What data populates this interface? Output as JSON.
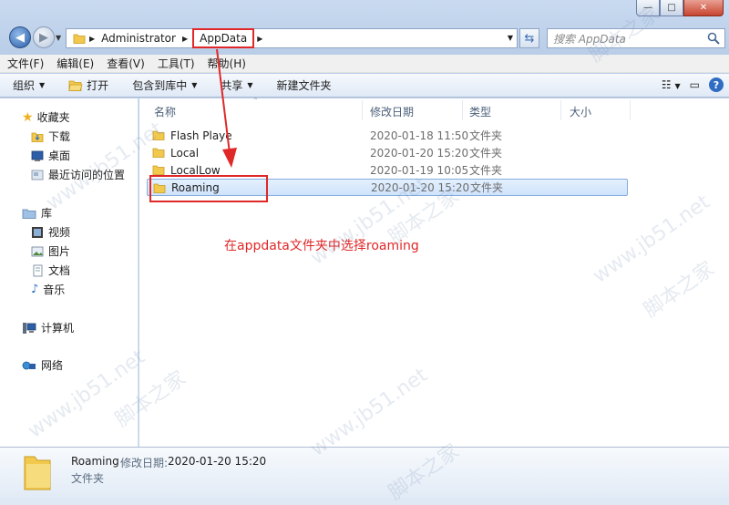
{
  "window": {
    "caption_buttons": {
      "minimize": "—",
      "maximize": "□",
      "close": "✕"
    }
  },
  "address": {
    "segments": [
      "Administrator",
      "AppData"
    ],
    "search_placeholder": "搜索 AppData"
  },
  "menu": [
    "文件(F)",
    "编辑(E)",
    "查看(V)",
    "工具(T)",
    "帮助(H)"
  ],
  "commands": {
    "organize": "组织",
    "open": "打开",
    "include_library": "包含到库中",
    "share": "共享",
    "new_folder": "新建文件夹"
  },
  "nav_pane": {
    "favorites": "收藏夹",
    "downloads": "下载",
    "desktop": "桌面",
    "recent": "最近访问的位置",
    "libraries": "库",
    "videos": "视频",
    "pictures": "图片",
    "documents": "文档",
    "music": "音乐",
    "computer": "计算机",
    "network": "网络"
  },
  "columns": {
    "name": "名称",
    "modified": "修改日期",
    "type": "类型",
    "size": "大小"
  },
  "files": [
    {
      "name": "Flash Playe",
      "modified": "2020-01-18 11:50",
      "type": "文件夹"
    },
    {
      "name": "Local",
      "modified": "2020-01-20 15:20",
      "type": "文件夹"
    },
    {
      "name": "LocalLow",
      "modified": "2020-01-19 10:05",
      "type": "文件夹"
    },
    {
      "name": "Roaming",
      "modified": "2020-01-20 15:20",
      "type": "文件夹"
    }
  ],
  "annotation": "在appdata文件夹中选择roaming",
  "details": {
    "name": "Roaming",
    "modified_label": "修改日期:",
    "modified_value": "2020-01-20 15:20",
    "type": "文件夹"
  },
  "watermark": {
    "site": "www.jb51.net",
    "brand": "脚本之家"
  },
  "colors": {
    "annotation": "#e02828",
    "selection": "#cfe3fb",
    "folder": "#f2c94c"
  }
}
